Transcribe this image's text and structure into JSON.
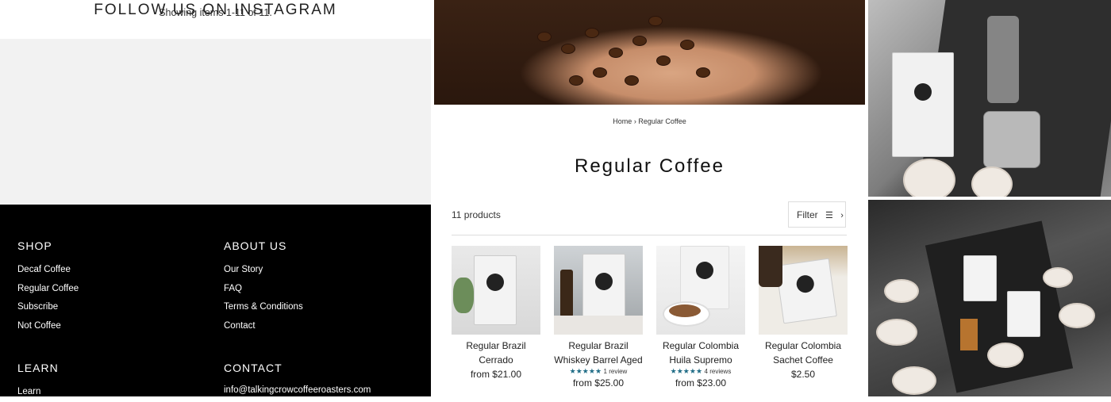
{
  "pagination": {
    "text": "Showing items 1-11 of 11."
  },
  "instagram": {
    "heading": "FOLLOW US ON INSTAGRAM"
  },
  "footer": {
    "shop": {
      "heading": "SHOP",
      "links": [
        "Decaf Coffee",
        "Regular Coffee",
        "Subscribe",
        "Not Coffee"
      ]
    },
    "about": {
      "heading": "ABOUT US",
      "links": [
        "Our Story",
        "FAQ",
        "Terms & Conditions",
        "Contact"
      ]
    },
    "learn": {
      "heading": "LEARN",
      "links": [
        "Learn"
      ]
    },
    "contact": {
      "heading": "CONTACT",
      "email": "info@talkingcrowcoffeeroasters.com"
    }
  },
  "collection": {
    "breadcrumb": {
      "home": "Home",
      "separator": "›",
      "current": "Regular Coffee"
    },
    "title": "Regular Coffee",
    "count": "11 products",
    "filter_label": "Filter",
    "products": [
      {
        "name": "Regular Brazil Cerrado",
        "price": "from $21.00"
      },
      {
        "name": "Regular Brazil Whiskey Barrel Aged",
        "stars": "★★★★★",
        "reviews": "1 review",
        "price": "from $25.00"
      },
      {
        "name": "Regular Colombia Huila Supremo",
        "stars": "★★★★★",
        "reviews": "4 reviews",
        "price": "from $23.00"
      },
      {
        "name": "Regular Colombia Sachet Coffee",
        "price": "$2.50"
      }
    ]
  },
  "colors": {
    "star": "#1f6c86",
    "footer_bg": "#000000",
    "instagram_bg": "#f2f2f2"
  },
  "icons": {
    "filter": "sliders-icon",
    "chevron": "chevron-right-icon"
  }
}
